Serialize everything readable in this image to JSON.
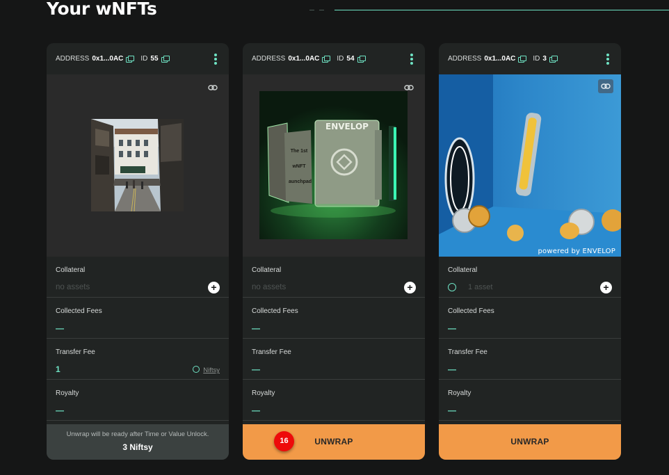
{
  "page": {
    "title": "Your wNFTs"
  },
  "cards": [
    {
      "address_label": "ADDRESS",
      "address": "0x1...0AC",
      "id_label": "ID",
      "id": "55",
      "collateral_label": "Collateral",
      "collateral_value": "no assets",
      "fees_label": "Collected Fees",
      "fees_value": "—",
      "transfer_label": "Transfer Fee",
      "transfer_value": "1",
      "transfer_token": "Niftsy",
      "royalty_label": "Royalty",
      "royalty_value": "—",
      "footer_note": "Unwrap will be ready after Time or Value Unlock.",
      "footer_price": "3 Niftsy"
    },
    {
      "address_label": "ADDRESS",
      "address": "0x1...0AC",
      "id_label": "ID",
      "id": "54",
      "image_text": "ENVELOP",
      "image_side_text": [
        "The 1st",
        "wNFT",
        "aunchpad"
      ],
      "collateral_label": "Collateral",
      "collateral_value": "no assets",
      "fees_label": "Collected Fees",
      "fees_value": "—",
      "transfer_label": "Transfer Fee",
      "transfer_value": "—",
      "royalty_label": "Royalty",
      "royalty_value": "—",
      "unwrap_label": "UNWRAP",
      "badge_count": "16"
    },
    {
      "address_label": "ADDRESS",
      "address": "0x1...0AC",
      "id_label": "ID",
      "id": "3",
      "watermark": "powered by ENVELOP",
      "collateral_label": "Collateral",
      "collateral_value": "1 asset",
      "fees_label": "Collected Fees",
      "fees_value": "—",
      "transfer_label": "Transfer Fee",
      "transfer_value": "—",
      "royalty_label": "Royalty",
      "royalty_value": "—",
      "unwrap_label": "UNWRAP"
    }
  ],
  "colors": {
    "accent": "#6fe3c4",
    "unwrap": "#f29a48",
    "badge": "#ee0a0a",
    "card": "#212423",
    "background": "#151616"
  }
}
